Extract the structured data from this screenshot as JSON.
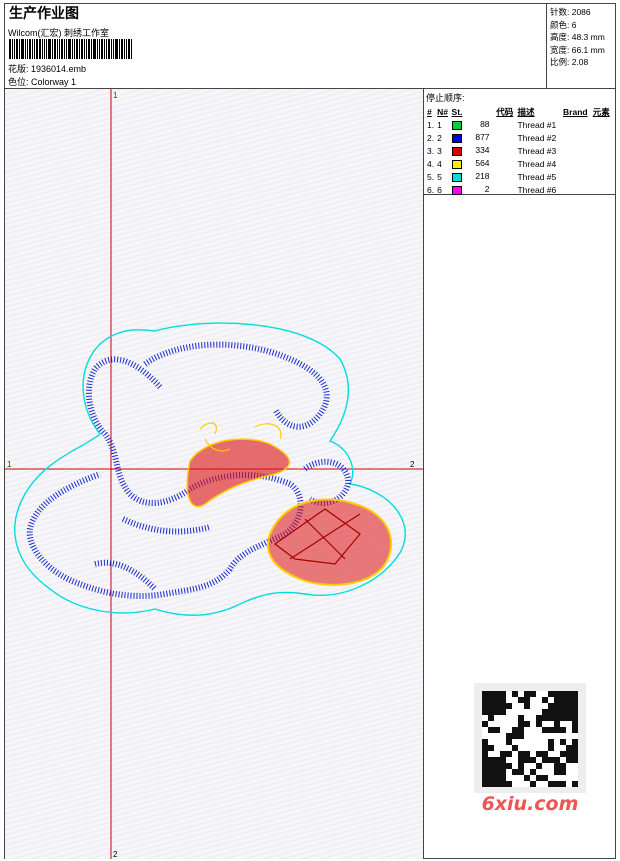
{
  "header": {
    "title": "生产作业图",
    "company": "Wilcom(汇宏) 刺绣工作室",
    "design_label": "花版: 1936014.emb",
    "colorway_label": "色位: Colorway 1"
  },
  "specs": {
    "stitches": "针数: 2086",
    "colors": "颜色: 6",
    "height": "高度: 48.3 mm",
    "width": "宽度: 66.1 mm",
    "scale": "比例: 2.08"
  },
  "stop_sequence": {
    "title": "停止顺序:",
    "columns": [
      "#",
      "N#",
      "St.",
      "代码",
      "描述",
      "Brand",
      "元素"
    ],
    "rows": [
      {
        "n": "1.",
        "nn": "1",
        "color": "#00cc33",
        "st": "88",
        "desc": "Thread #1"
      },
      {
        "n": "2.",
        "nn": "2",
        "color": "#0000dd",
        "st": "877",
        "desc": "Thread #2"
      },
      {
        "n": "3.",
        "nn": "3",
        "color": "#dd0000",
        "st": "334",
        "desc": "Thread #3"
      },
      {
        "n": "4.",
        "nn": "4",
        "color": "#ffee00",
        "st": "564",
        "desc": "Thread #4"
      },
      {
        "n": "5.",
        "nn": "5",
        "color": "#00dddd",
        "st": "218",
        "desc": "Thread #5"
      },
      {
        "n": "6.",
        "nn": "6",
        "color": "#ff00ff",
        "st": "2",
        "desc": "Thread #6"
      }
    ]
  },
  "axes": {
    "v_top": "1",
    "v_bottom": "2",
    "h_left": "1",
    "h_right": "2"
  },
  "watermark": "6xiu.com",
  "colors": {
    "outline": "#00dddd",
    "stitch": "#1a2ad0",
    "fill": "#dd1111",
    "accent": "#ffcc00",
    "crosshair": "#cc0000"
  }
}
